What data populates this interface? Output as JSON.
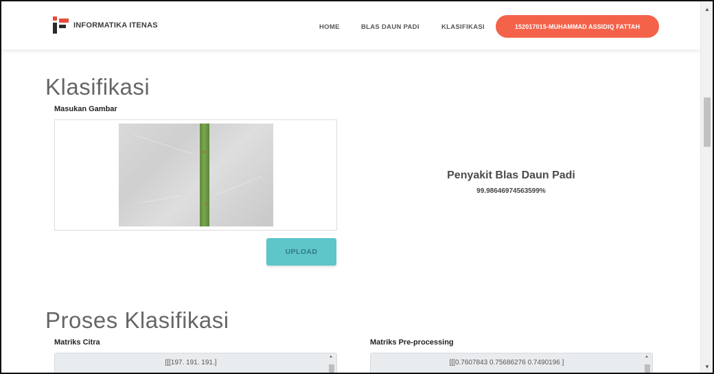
{
  "navbar": {
    "brand": "INFORMATIKA ITENAS",
    "links": [
      "HOME",
      "BLAS DAUN PADI",
      "KLASIFIKASI"
    ],
    "user_button": "152017015-MUHAMMAD ASSIDIQ FATTAH"
  },
  "section1": {
    "title": "Klasifikasi",
    "input_label": "Masukan Gambar",
    "upload_label": "UPLOAD"
  },
  "result": {
    "title": "Penyakit Blas Daun Padi",
    "confidence": "99.98646974563599%"
  },
  "section2": {
    "title": "Proses Klasifikasi",
    "matrix_label": "Matriks Citra",
    "matrix_value": "[[[197. 191. 191.]",
    "pre_label": "Matriks Pre-processing",
    "pre_value": "[[[0.7607843  0.75686276 0.7490196 ]"
  },
  "colors": {
    "accent": "#f4624a",
    "upload": "#5ec5c9",
    "logo_red": "#e84a3c",
    "logo_dark": "#2b2b2b"
  },
  "icons": [
    "brand-logo-icon",
    "scroll-up-arrow-icon",
    "scroll-down-arrow-icon"
  ]
}
